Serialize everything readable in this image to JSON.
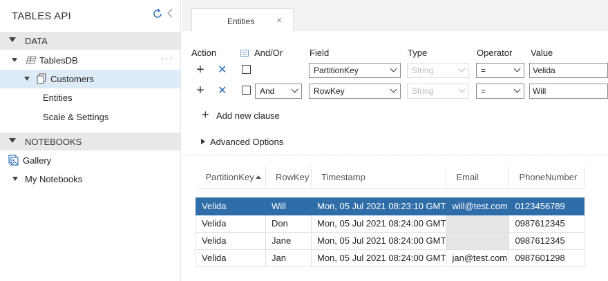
{
  "sidebar": {
    "title": "TABLES API",
    "sections": {
      "data": "DATA",
      "notebooks": "NOTEBOOKS"
    },
    "tree": {
      "database": "TablesDB",
      "database_more": "···",
      "table": "Customers",
      "entities": "Entities",
      "scale": "Scale & Settings",
      "gallery": "Gallery",
      "my_notebooks": "My Notebooks"
    }
  },
  "tabs": [
    {
      "label": "Entities",
      "close": "×"
    }
  ],
  "query": {
    "headers": {
      "action": "Action",
      "andor": "And/Or",
      "field": "Field",
      "type": "Type",
      "operator": "Operator",
      "value": "Value"
    },
    "clauses": [
      {
        "andor": "",
        "field": "PartitionKey",
        "type": "String",
        "operator": "=",
        "value": "Velida"
      },
      {
        "andor": "And",
        "field": "RowKey",
        "type": "String",
        "operator": "=",
        "value": "Will"
      }
    ],
    "add_clause": "Add new clause",
    "advanced": "Advanced Options"
  },
  "grid": {
    "columns": [
      "PartitionKey",
      "RowKey",
      "Timestamp",
      "Email",
      "PhoneNumber"
    ],
    "rows": [
      [
        "Velida",
        "Will",
        "Mon, 05 Jul 2021 08:23:10 GMT",
        "will@test.com",
        "0123456789"
      ],
      [
        "Velida",
        "Don",
        "Mon, 05 Jul 2021 08:24:00 GMT",
        "",
        "0987612345"
      ],
      [
        "Velida",
        "Jane",
        "Mon, 05 Jul 2021 08:24:00 GMT",
        "",
        "0987612345"
      ],
      [
        "Velida",
        "Jan",
        "Mon, 05 Jul 2021 08:24:00 GMT",
        "jan@test.com",
        "0987601298"
      ]
    ],
    "selected_row": 0,
    "sorted_column": "PartitionKey"
  },
  "colors": {
    "accent": "#2f6da8",
    "selected_tree": "#ddeaf7",
    "section_bg": "#e8e8e8"
  }
}
